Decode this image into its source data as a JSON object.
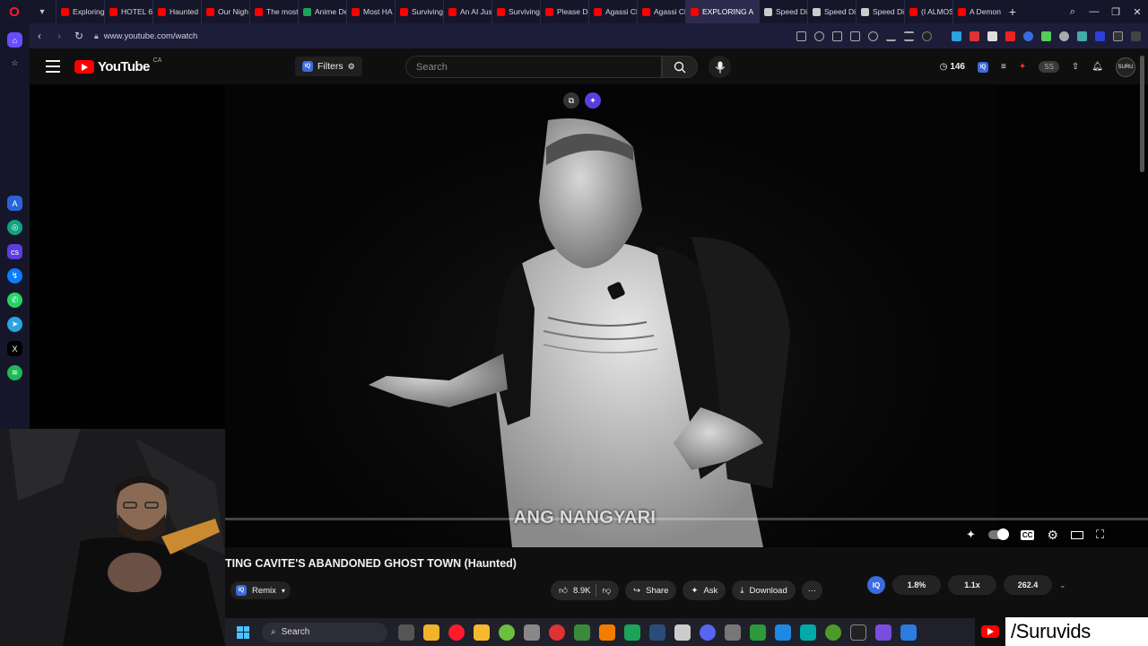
{
  "browser": {
    "tabs": [
      {
        "label": "Exploring",
        "color": "#ff0000"
      },
      {
        "label": "HOTEL 6",
        "color": "#ff0000"
      },
      {
        "label": "Haunted",
        "color": "#ff0000"
      },
      {
        "label": "Our Nigh",
        "color": "#ff0000"
      },
      {
        "label": "The most",
        "color": "#ff0000"
      },
      {
        "label": "Anime De",
        "color": "#1ba35a"
      },
      {
        "label": "Most HA",
        "color": "#ff0000"
      },
      {
        "label": "Surviving",
        "color": "#ff0000"
      },
      {
        "label": "An AI Just",
        "color": "#ff0000"
      },
      {
        "label": "Surviving",
        "color": "#ff0000"
      },
      {
        "label": "Please Do",
        "color": "#ff0000"
      },
      {
        "label": "Agassi Ch",
        "color": "#ff0000"
      },
      {
        "label": "Agassi Ch",
        "color": "#ff0000"
      },
      {
        "label": "EXPLORING A",
        "color": "#ff0000",
        "active": true
      },
      {
        "label": "Speed Di",
        "color": "#cccccc"
      },
      {
        "label": "Speed Di",
        "color": "#cccccc"
      },
      {
        "label": "Speed Di",
        "color": "#cccccc"
      },
      {
        "label": "(I ALMOS",
        "color": "#ff0000"
      },
      {
        "label": "A Demon",
        "color": "#ff0000"
      }
    ],
    "url": "www.youtube.com/watch"
  },
  "youtube": {
    "logo_text": "YouTube",
    "region": "CA",
    "filters_label": "Filters",
    "search_placeholder": "Search",
    "counter": "146",
    "ss_label": "SS",
    "avatar_text": "SURU"
  },
  "video": {
    "subtitle": "ANG NANGYARI",
    "title": "TING CAVITE'S ABANDONED GHOST TOWN (Haunted)"
  },
  "actions": {
    "remix": "Remix",
    "likes": "8.9K",
    "share": "Share",
    "ask": "Ask",
    "download": "Download",
    "more": "···"
  },
  "extension": {
    "iq": "IQ",
    "stat1": "1.8%",
    "stat2": "1.1x",
    "stat3": "262.4"
  },
  "taskbar": {
    "search": "Search"
  },
  "brand": {
    "text": "/Suruvids"
  }
}
